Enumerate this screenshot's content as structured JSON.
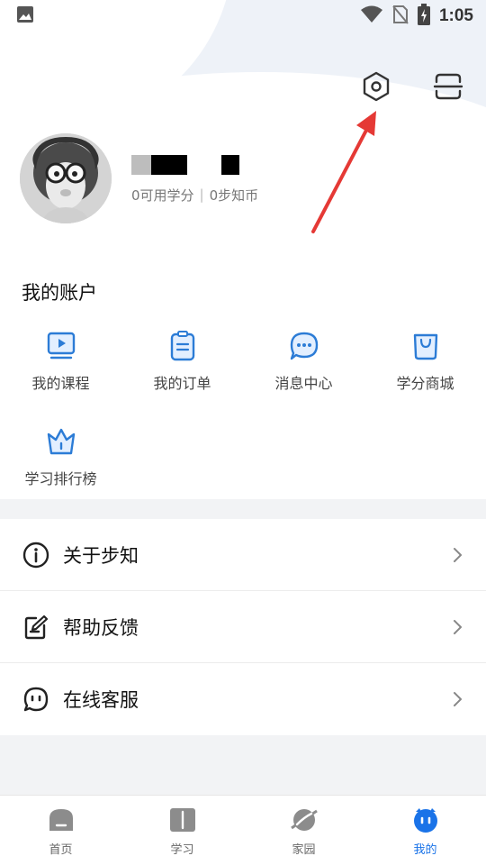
{
  "status_bar": {
    "time": "1:05"
  },
  "profile": {
    "credits": "0可用学分",
    "coins": "0步知币"
  },
  "account": {
    "title": "我的账户",
    "items": [
      {
        "label": "我的课程",
        "icon": "play-video-icon"
      },
      {
        "label": "我的订单",
        "icon": "clipboard-icon"
      },
      {
        "label": "消息中心",
        "icon": "chat-bubble-icon"
      },
      {
        "label": "学分商城",
        "icon": "shopping-bag-icon"
      },
      {
        "label": "学习排行榜",
        "icon": "crown-icon"
      }
    ]
  },
  "menu": [
    {
      "label": "关于步知",
      "icon": "info-circle-icon"
    },
    {
      "label": "帮助反馈",
      "icon": "edit-note-icon"
    },
    {
      "label": "在线客服",
      "icon": "chat-dots-icon"
    }
  ],
  "tabs": [
    {
      "label": "首页",
      "icon": "home-icon"
    },
    {
      "label": "学习",
      "icon": "book-icon"
    },
    {
      "label": "家园",
      "icon": "planet-icon"
    },
    {
      "label": "我的",
      "icon": "profile-face-icon",
      "active": true
    }
  ],
  "colors": {
    "accent": "#1a73e8",
    "icon_blue": "#2c7cd6",
    "arrow_red": "#e53935"
  }
}
